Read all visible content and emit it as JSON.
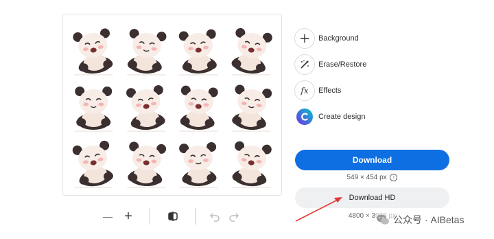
{
  "preview": {
    "sticker_count": 12,
    "sticker_name": "panda-sticker"
  },
  "toolbar": {
    "zoom_out_label": "—",
    "zoom_in_label": "+"
  },
  "tools": [
    {
      "label": "Background",
      "icon": "plus-icon"
    },
    {
      "label": "Erase/Restore",
      "icon": "magic-brush-icon"
    },
    {
      "label": "Effects",
      "icon": "fx-icon"
    },
    {
      "label": "Create design",
      "icon": "canva-logo-icon"
    }
  ],
  "download": {
    "primary_label": "Download",
    "primary_size": "549 × 454 px",
    "hd_label": "Download HD",
    "hd_size": "4800 × 3968 px"
  },
  "watermark": {
    "text": "公众号 · AIBetas"
  },
  "colors": {
    "primary": "#0e6fe2",
    "secondary_bg": "#eef0f2",
    "arrow": "#e53935"
  }
}
